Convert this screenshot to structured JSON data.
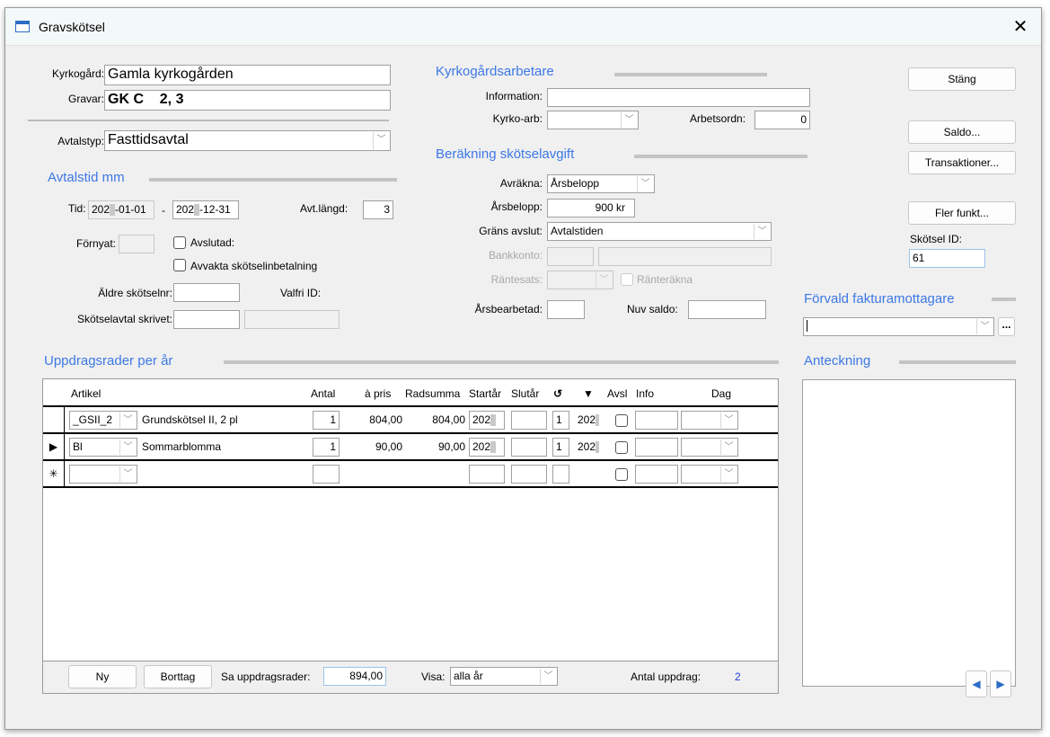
{
  "window": {
    "title": "Gravskötsel"
  },
  "top": {
    "kyrkogard_label": "Kyrkogård:",
    "kyrkogard_value": "Gamla kyrkogården",
    "gravar_label": "Gravar:",
    "gravar_value": "GK C    2, 3",
    "avtalstyp_label": "Avtalstyp:",
    "avtalstyp_value": "Fasttidsavtal"
  },
  "avtalstid": {
    "heading": "Avtalstid mm",
    "tid_label": "Tid:",
    "from_prefix": "202",
    "from_suffix": "-01-01",
    "dash": "-",
    "to_prefix": "202",
    "to_suffix": "-12-31",
    "langd_label": "Avt.längd:",
    "langd_value": "3",
    "fornyat_label": "Förnyat:",
    "avslutad_label": "Avslutad:",
    "avvakta_label": "Avvakta skötselinbetalning",
    "aldre_label": "Äldre skötselnr:",
    "valfri_label": "Valfri ID:",
    "skrivet_label": "Skötselavtal skrivet:"
  },
  "arbetare": {
    "heading": "Kyrkogårdsarbetare",
    "information_label": "Information:",
    "kyrkoarb_label": "Kyrko-arb:",
    "arbetsordn_label": "Arbetsordn:",
    "arbetsordn_value": "0"
  },
  "berakning": {
    "heading": "Beräkning skötselavgift",
    "avrakna_label": "Avräkna:",
    "avrakna_value": "Årsbelopp",
    "arsbelopp_label": "Årsbelopp:",
    "arsbelopp_value": "900 kr",
    "grans_label": "Gräns avslut:",
    "grans_value": "Avtalstiden",
    "bankkonto_label": "Bankkonto:",
    "rantesats_label": "Räntesats:",
    "rantrakna_label": "Ränteräkna",
    "arsbearbetad_label": "Årsbearbetad:",
    "nuvsaldo_label": "Nuv saldo:"
  },
  "buttons": {
    "stang": "Stäng",
    "saldo": "Saldo...",
    "transaktioner": "Transaktioner...",
    "fler": "Fler funkt..."
  },
  "skotsel": {
    "id_label": "Skötsel ID:",
    "id_value": "61"
  },
  "faktura": {
    "heading": "Förvald fakturamottagare",
    "more": "..."
  },
  "anteckning": {
    "heading": "Anteckning"
  },
  "uppdrag": {
    "heading": "Uppdragsrader per år",
    "columns": {
      "artikel": "Artikel",
      "antal": "Antal",
      "apris": "à pris",
      "radsumma": "Radsumma",
      "startar": "Startår",
      "slutar": "Slutår",
      "repeat": "↺",
      "sort": "▼",
      "avsl": "Avsl",
      "info": "Info",
      "dag": "Dag"
    },
    "rows": [
      {
        "selector": "",
        "code": "_GSII_2",
        "name": "Grundskötsel II, 2 pl",
        "antal": "1",
        "apris": "804,00",
        "radsumma": "804,00",
        "startar": "202",
        "interval": "1",
        "year": "202"
      },
      {
        "selector": "▶",
        "code": "Bl",
        "name": "Sommarblomma",
        "antal": "1",
        "apris": "90,00",
        "radsumma": "90,00",
        "startar": "202",
        "interval": "1",
        "year": "202"
      }
    ],
    "new_row_marker": "✳",
    "footer": {
      "ny": "Ny",
      "borttag": "Borttag",
      "summa_label": "Sa uppdragsrader:",
      "summa_value": "894,00",
      "visa_label": "Visa:",
      "visa_value": "alla år",
      "antal_label": "Antal uppdrag:",
      "antal_value": "2"
    }
  }
}
